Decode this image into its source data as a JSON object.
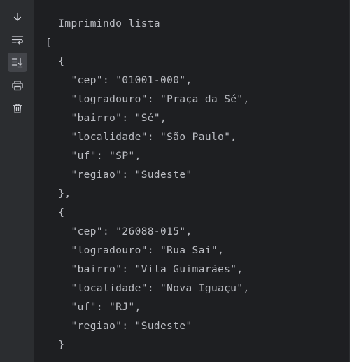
{
  "toolbar": {
    "buttons": [
      {
        "name": "scroll-down-icon",
        "active": false
      },
      {
        "name": "soft-wrap-icon",
        "active": false
      },
      {
        "name": "scroll-to-end-icon",
        "active": true
      },
      {
        "name": "print-icon",
        "active": false
      },
      {
        "name": "clear-all-icon",
        "active": false
      }
    ]
  },
  "console": {
    "lines": [
      "__Imprimindo lista__",
      "[",
      "  {",
      "    \"cep\": \"01001-000\",",
      "    \"logradouro\": \"Praça da Sé\",",
      "    \"bairro\": \"Sé\",",
      "    \"localidade\": \"São Paulo\",",
      "    \"uf\": \"SP\",",
      "    \"regiao\": \"Sudeste\"",
      "  },",
      "  {",
      "    \"cep\": \"26088-015\",",
      "    \"logradouro\": \"Rua Sai\",",
      "    \"bairro\": \"Vila Guimarães\",",
      "    \"localidade\": \"Nova Iguaçu\",",
      "    \"uf\": \"RJ\",",
      "    \"regiao\": \"Sudeste\"",
      "  }"
    ]
  },
  "colors": {
    "background": "#1e1f22",
    "gutter": "#2b2d30",
    "text": "#bcbec4",
    "icon": "#ced0d6",
    "active_button": "#43454a"
  }
}
